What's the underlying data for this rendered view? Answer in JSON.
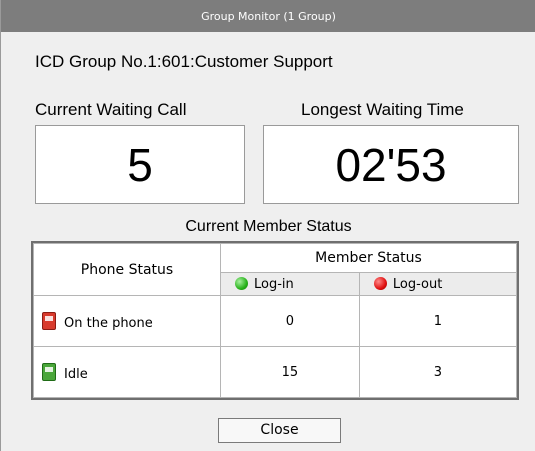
{
  "window": {
    "title": "Group Monitor (1 Group)"
  },
  "group": {
    "name": "ICD Group No.1:601:Customer Support"
  },
  "waiting": {
    "label": "Current Waiting Call",
    "value": "5"
  },
  "longest": {
    "label": "Longest Waiting Time",
    "value": "02'53"
  },
  "member_status_title": "Current Member Status",
  "table": {
    "phone_status_header": "Phone Status",
    "member_status_header": "Member Status",
    "login_label": "Log-in",
    "logout_label": "Log-out",
    "rows": [
      {
        "label": "On the phone",
        "icon": "red-phone-icon",
        "login": "0",
        "logout": "1"
      },
      {
        "label": "Idle",
        "icon": "green-phone-icon",
        "login": "15",
        "logout": "3"
      }
    ]
  },
  "buttons": {
    "close_label": "Close"
  },
  "colors": {
    "login_dot": "#27b21a",
    "logout_dot": "#e01010",
    "titlebar": "#7d7d7d"
  }
}
